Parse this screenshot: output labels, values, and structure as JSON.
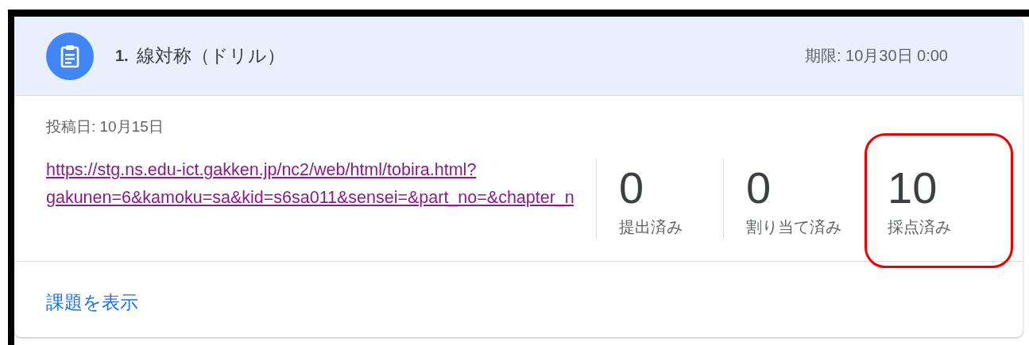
{
  "assignment": {
    "number": "1.",
    "title": "線対称（ドリル）",
    "due": "期限: 10月30日 0:00"
  },
  "posted": "投稿日: 10月15日",
  "link_lines": [
    "https://stg.ns.edu-ict.gakken.jp/nc2/web/html/tobira.html?",
    "gakunen=6&kamoku=sa&kid=s6sa011&sensei=&part_no=&chapter_n"
  ],
  "stats": [
    {
      "count": "0",
      "label": "提出済み",
      "highlighted": false
    },
    {
      "count": "0",
      "label": "割り当て済み",
      "highlighted": false
    },
    {
      "count": "10",
      "label": "採点済み",
      "highlighted": true
    }
  ],
  "view_link": "課題を表示"
}
